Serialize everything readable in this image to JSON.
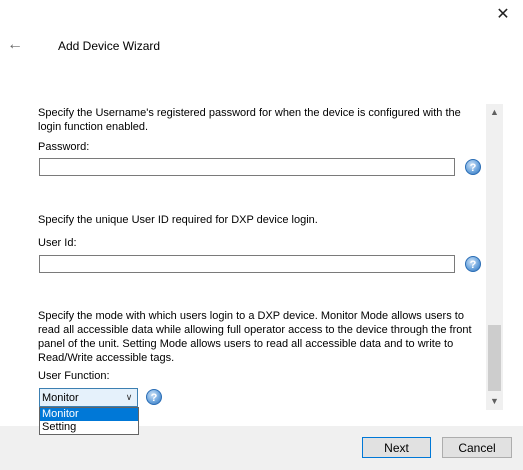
{
  "window": {
    "title": "Add Device Wizard"
  },
  "sections": {
    "password": {
      "description": "Specify the Username's registered password for when the device is configured with the login function enabled.",
      "label": "Password:",
      "value": ""
    },
    "user_id": {
      "description": "Specify the unique User ID required for DXP device login.",
      "label": "User Id:",
      "value": ""
    },
    "user_function": {
      "description": "Specify the mode with which users login to a DXP device. Monitor Mode allows users to read all accessible data while allowing full operator access to the device through the front panel of the unit. Setting Mode allows users to read all accessible data and to write to Read/Write accessible tags.",
      "label": "User Function:",
      "selected": "Monitor",
      "options": [
        "Monitor",
        "Setting"
      ]
    }
  },
  "help_glyph": "?",
  "footer": {
    "next_label": "Next",
    "cancel_label": "Cancel"
  },
  "icons": {
    "close": "close-icon",
    "back": "back-arrow-icon",
    "help": "help-icon"
  }
}
